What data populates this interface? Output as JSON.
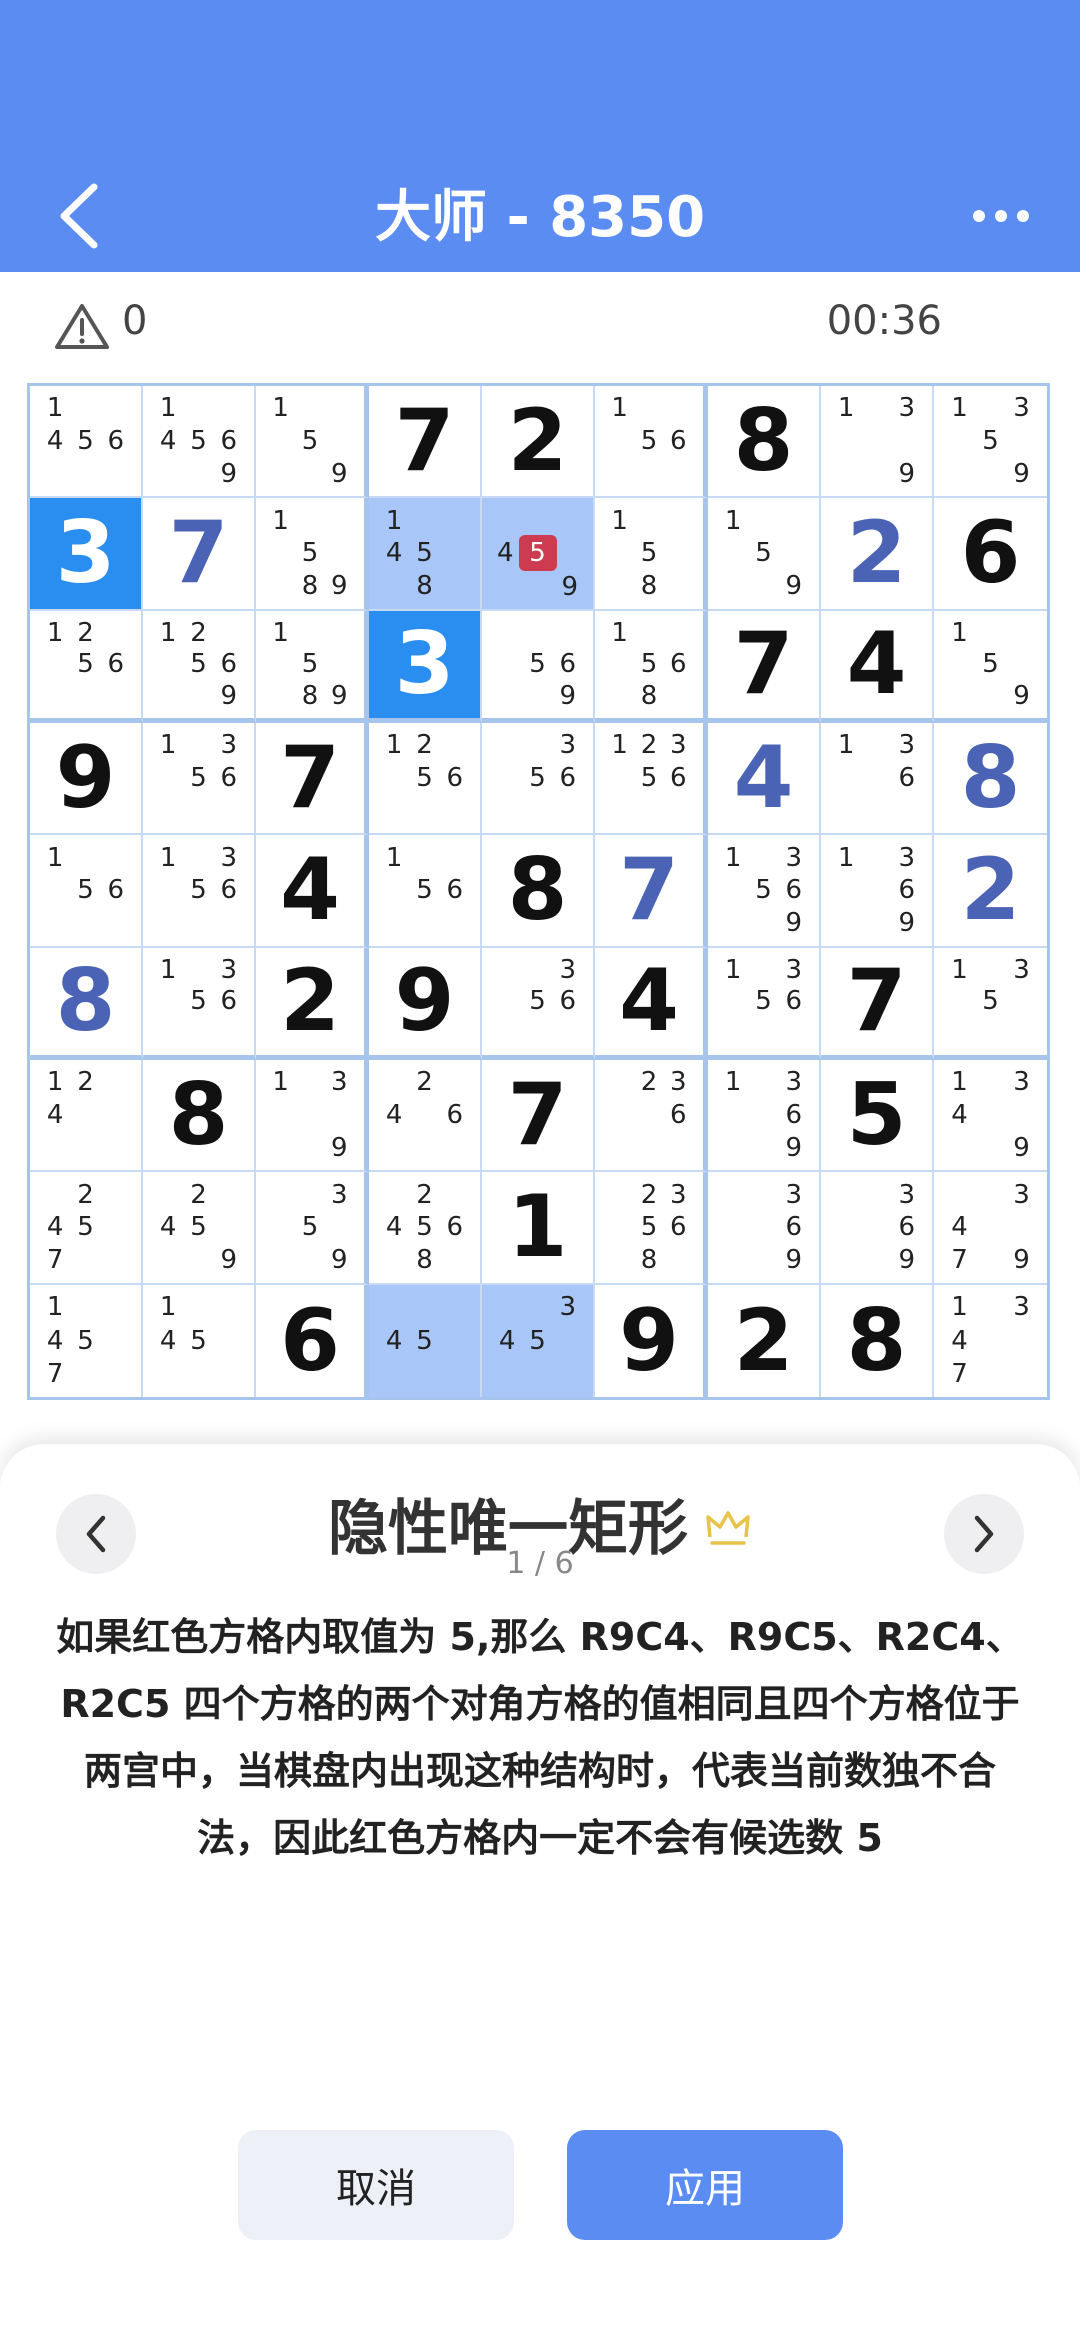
{
  "header": {
    "title": "大师 - 8350",
    "back_icon": "chevron-left-icon",
    "more_icon": "more-dots-icon"
  },
  "status": {
    "mistakes": "0",
    "timer": "00:36"
  },
  "board": {
    "rows": [
      [
        {
          "c": [
            1,
            4,
            5,
            6
          ]
        },
        {
          "c": [
            1,
            4,
            5,
            6,
            9
          ]
        },
        {
          "c": [
            1,
            5,
            9
          ]
        },
        {
          "v": "7",
          "t": "given"
        },
        {
          "v": "2",
          "t": "given"
        },
        {
          "c": [
            1,
            5,
            6
          ]
        },
        {
          "v": "8",
          "t": "given"
        },
        {
          "c": [
            1,
            3,
            9
          ]
        },
        {
          "c": [
            1,
            3,
            5,
            9
          ]
        }
      ],
      [
        {
          "v": "3",
          "t": "given",
          "s": "sel"
        },
        {
          "v": "7",
          "t": "user"
        },
        {
          "c": [
            1,
            5,
            8,
            9
          ]
        },
        {
          "c": [
            1,
            4,
            5,
            8
          ],
          "s": "hl"
        },
        {
          "c": [
            4,
            5,
            9
          ],
          "red": 5,
          "s": "hl"
        },
        {
          "c": [
            1,
            5,
            8
          ]
        },
        {
          "c": [
            1,
            5,
            9
          ]
        },
        {
          "v": "2",
          "t": "user"
        },
        {
          "v": "6",
          "t": "given"
        }
      ],
      [
        {
          "c": [
            1,
            2,
            5,
            6
          ]
        },
        {
          "c": [
            1,
            2,
            5,
            6,
            9
          ]
        },
        {
          "c": [
            1,
            5,
            8,
            9
          ]
        },
        {
          "v": "3",
          "t": "given",
          "s": "sel"
        },
        {
          "c": [
            5,
            6,
            9
          ]
        },
        {
          "c": [
            1,
            5,
            6,
            8
          ]
        },
        {
          "v": "7",
          "t": "given"
        },
        {
          "v": "4",
          "t": "given"
        },
        {
          "c": [
            1,
            5,
            9
          ]
        }
      ],
      [
        {
          "v": "9",
          "t": "given"
        },
        {
          "c": [
            1,
            3,
            5,
            6
          ]
        },
        {
          "v": "7",
          "t": "given"
        },
        {
          "c": [
            1,
            2,
            5,
            6
          ]
        },
        {
          "c": [
            3,
            5,
            6
          ]
        },
        {
          "c": [
            1,
            2,
            3,
            5,
            6
          ]
        },
        {
          "v": "4",
          "t": "user"
        },
        {
          "c": [
            1,
            3,
            6
          ]
        },
        {
          "v": "8",
          "t": "user"
        }
      ],
      [
        {
          "c": [
            1,
            5,
            6
          ]
        },
        {
          "c": [
            1,
            3,
            5,
            6
          ]
        },
        {
          "v": "4",
          "t": "given"
        },
        {
          "c": [
            1,
            5,
            6
          ]
        },
        {
          "v": "8",
          "t": "given"
        },
        {
          "v": "7",
          "t": "user"
        },
        {
          "c": [
            1,
            3,
            5,
            6,
            9
          ]
        },
        {
          "c": [
            1,
            3,
            6,
            9
          ]
        },
        {
          "v": "2",
          "t": "user"
        }
      ],
      [
        {
          "v": "8",
          "t": "user"
        },
        {
          "c": [
            1,
            3,
            5,
            6
          ]
        },
        {
          "v": "2",
          "t": "given"
        },
        {
          "v": "9",
          "t": "given"
        },
        {
          "c": [
            3,
            5,
            6
          ]
        },
        {
          "v": "4",
          "t": "given"
        },
        {
          "c": [
            1,
            3,
            5,
            6
          ]
        },
        {
          "v": "7",
          "t": "given"
        },
        {
          "c": [
            1,
            3,
            5
          ]
        }
      ],
      [
        {
          "c": [
            1,
            2,
            4
          ]
        },
        {
          "v": "8",
          "t": "given"
        },
        {
          "c": [
            1,
            3,
            9
          ]
        },
        {
          "c": [
            2,
            4,
            6
          ]
        },
        {
          "v": "7",
          "t": "given"
        },
        {
          "c": [
            2,
            3,
            6
          ]
        },
        {
          "c": [
            1,
            3,
            6,
            9
          ]
        },
        {
          "v": "5",
          "t": "given"
        },
        {
          "c": [
            1,
            3,
            4,
            9
          ]
        }
      ],
      [
        {
          "c": [
            2,
            4,
            5,
            7
          ]
        },
        {
          "c": [
            2,
            4,
            5,
            9
          ]
        },
        {
          "c": [
            3,
            5,
            9
          ]
        },
        {
          "c": [
            2,
            4,
            5,
            6,
            8
          ]
        },
        {
          "v": "1",
          "t": "given"
        },
        {
          "c": [
            2,
            3,
            5,
            6,
            8
          ]
        },
        {
          "c": [
            3,
            6,
            9
          ]
        },
        {
          "c": [
            3,
            6,
            9
          ]
        },
        {
          "c": [
            3,
            4,
            7,
            9
          ]
        }
      ],
      [
        {
          "c": [
            1,
            4,
            5,
            7
          ]
        },
        {
          "c": [
            1,
            4,
            5
          ]
        },
        {
          "v": "6",
          "t": "given"
        },
        {
          "c": [
            4,
            5
          ],
          "s": "hl"
        },
        {
          "c": [
            3,
            4,
            5
          ],
          "s": "hl"
        },
        {
          "v": "9",
          "t": "given"
        },
        {
          "v": "2",
          "t": "given"
        },
        {
          "v": "8",
          "t": "given"
        },
        {
          "c": [
            1,
            3,
            4,
            7
          ]
        }
      ]
    ]
  },
  "hint": {
    "title": "隐性唯一矩形",
    "badge_icon": "crown-icon",
    "page": "1 / 6",
    "description": "如果红色方格内取值为 5,那么 R9C4、R9C5、R2C4、R2C5 四个方格的两个对角方格的值相同且四个方格位于两宫中，当棋盘内出现这种结构时，代表当前数独不合法，因此红色方格内一定不会有候选数 5",
    "prev_icon": "chevron-left-icon",
    "next_icon": "chevron-right-icon"
  },
  "buttons": {
    "cancel": "取消",
    "apply": "应用"
  },
  "colors": {
    "header": "#5b8cf2",
    "selected": "#2a8ef1",
    "highlight": "#a8c6f7",
    "user_digit": "#4b63b5",
    "red_candidate": "#cc3b4f"
  }
}
